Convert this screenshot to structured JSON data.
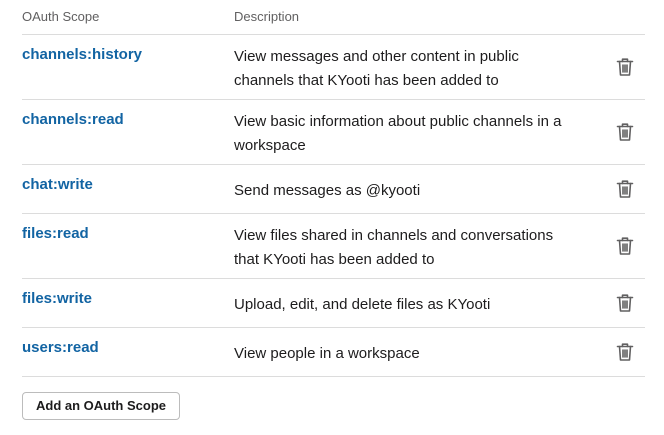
{
  "table": {
    "header": {
      "scope_label": "OAuth Scope",
      "description_label": "Description"
    },
    "rows": [
      {
        "scope": "channels:history",
        "description": "View messages and other content in public channels that KYooti has been added to",
        "action_icon": "trash-icon"
      },
      {
        "scope": "channels:read",
        "description": "View basic information about public channels in a workspace",
        "action_icon": "trash-icon"
      },
      {
        "scope": "chat:write",
        "description": "Send messages as @kyooti",
        "action_icon": "trash-icon"
      },
      {
        "scope": "files:read",
        "description": "View files shared in channels and conversations that KYooti has been added to",
        "action_icon": "trash-icon"
      },
      {
        "scope": "files:write",
        "description": "Upload, edit, and delete files as KYooti",
        "action_icon": "trash-icon"
      },
      {
        "scope": "users:read",
        "description": "View people in a workspace",
        "action_icon": "trash-icon"
      }
    ]
  },
  "actions": {
    "add_scope_label": "Add an OAuth Scope"
  },
  "colors": {
    "scope_link": "#1264a3",
    "text": "#1d1c1d",
    "muted": "#616061",
    "divider": "#dcdcdc"
  }
}
